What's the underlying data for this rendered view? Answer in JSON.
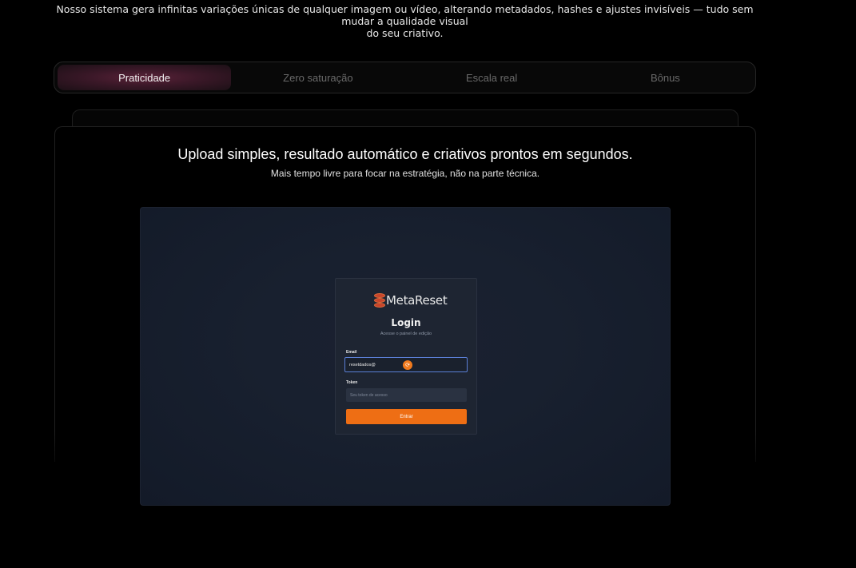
{
  "intro": {
    "line1": "Nosso sistema gera infinitas variações únicas de qualquer imagem ou vídeo, alterando metadados, hashes e ajustes invisíveis — tudo sem mudar a qualidade visual",
    "line2": "do seu criativo."
  },
  "tabs": [
    {
      "label": "Praticidade",
      "active": true
    },
    {
      "label": "Zero saturação",
      "active": false
    },
    {
      "label": "Escala real",
      "active": false
    },
    {
      "label": "Bônus",
      "active": false
    }
  ],
  "card": {
    "headline": "Upload simples, resultado automático e criativos prontos em segundos.",
    "subline": "Mais tempo livre para focar na estratégia, não na parte técnica."
  },
  "preview": {
    "brand": "MetaReset",
    "title": "Login",
    "subtitle": "Acesse o painel de edição",
    "email_label": "Email",
    "email_value": "resetdados@",
    "token_label": "Token",
    "token_placeholder": "Seu token de acesso",
    "submit_label": "Entrar",
    "brand_icon": "database-icon",
    "brand_color": "#c8452b",
    "accent_color": "#ee6e14"
  }
}
